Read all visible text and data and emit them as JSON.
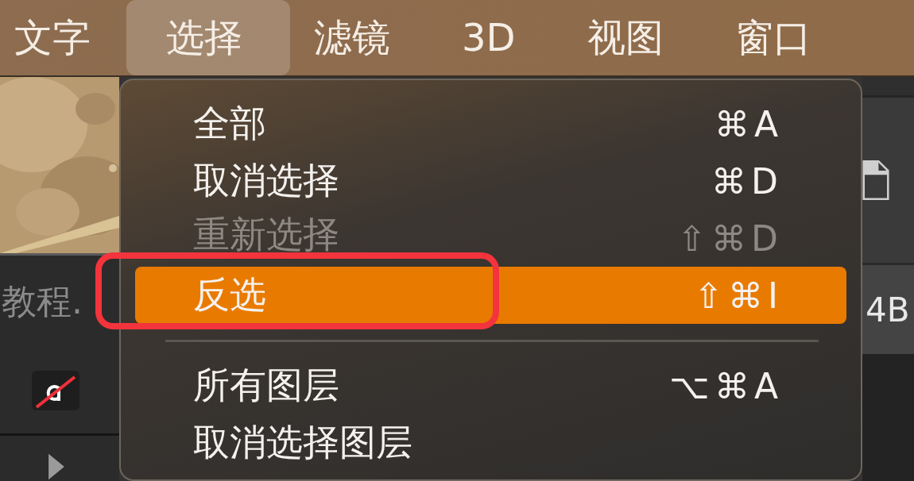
{
  "menu_bar": {
    "items": [
      {
        "label": "文字",
        "selected": false
      },
      {
        "label": "选择",
        "selected": true
      },
      {
        "label": "滤镜",
        "selected": false
      },
      {
        "label": "3D",
        "selected": false
      },
      {
        "label": "视图",
        "selected": false
      },
      {
        "label": "窗口",
        "selected": false
      }
    ]
  },
  "left_panel": {
    "document_name": "教程."
  },
  "right_panel": {
    "text": "4B"
  },
  "dropdown": {
    "items": [
      {
        "kind": "item",
        "label": "全部",
        "shortcut": "⌘A",
        "disabled": false,
        "selected": false
      },
      {
        "kind": "item",
        "label": "取消选择",
        "shortcut": "⌘D",
        "disabled": false,
        "selected": false
      },
      {
        "kind": "item",
        "label": "重新选择",
        "shortcut": "⇧⌘D",
        "disabled": true,
        "selected": false
      },
      {
        "kind": "item",
        "label": "反选",
        "shortcut": "⇧⌘I",
        "disabled": false,
        "selected": true
      },
      {
        "kind": "separator"
      },
      {
        "kind": "item",
        "label": "所有图层",
        "shortcut": "⌥⌘A",
        "disabled": false,
        "selected": false
      },
      {
        "kind": "item",
        "label": "取消选择图层",
        "disabled": false,
        "selected": false
      }
    ]
  }
}
